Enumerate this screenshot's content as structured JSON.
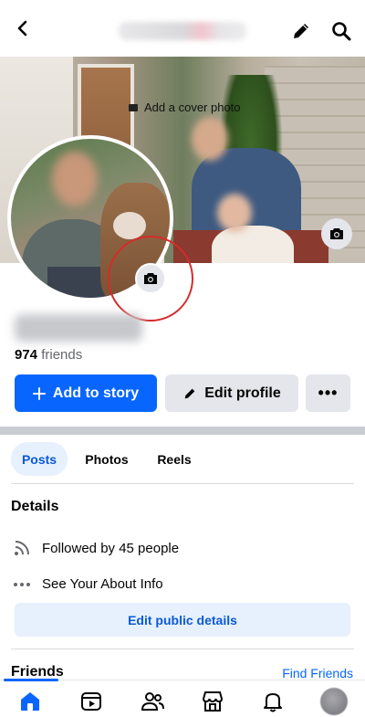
{
  "header": {
    "back_icon": "chevron-left-icon",
    "edit_icon": "pencil-icon",
    "search_icon": "search-icon"
  },
  "cover": {
    "add_cover_label": "Add a cover photo",
    "camera_icon": "camera-icon"
  },
  "profile": {
    "friends_count": "974",
    "friends_label": "friends"
  },
  "actions": {
    "add_story": "Add to story",
    "edit_profile": "Edit profile",
    "more": "•••"
  },
  "tabs": [
    {
      "label": "Posts",
      "active": true
    },
    {
      "label": "Photos",
      "active": false
    },
    {
      "label": "Reels",
      "active": false
    }
  ],
  "details": {
    "heading": "Details",
    "followed_by": "Followed by 45 people",
    "about": "See Your About Info",
    "edit_public": "Edit public details"
  },
  "friends_section": {
    "heading": "Friends",
    "find_friends": "Find Friends"
  },
  "nav": {
    "items": [
      "home-icon",
      "video-icon",
      "friends-icon",
      "marketplace-icon",
      "bell-icon",
      "profile-avatar"
    ]
  },
  "colors": {
    "primary": "#0866ff",
    "highlight": "#d62b2b",
    "tab_active_bg": "#e7f0fd"
  }
}
